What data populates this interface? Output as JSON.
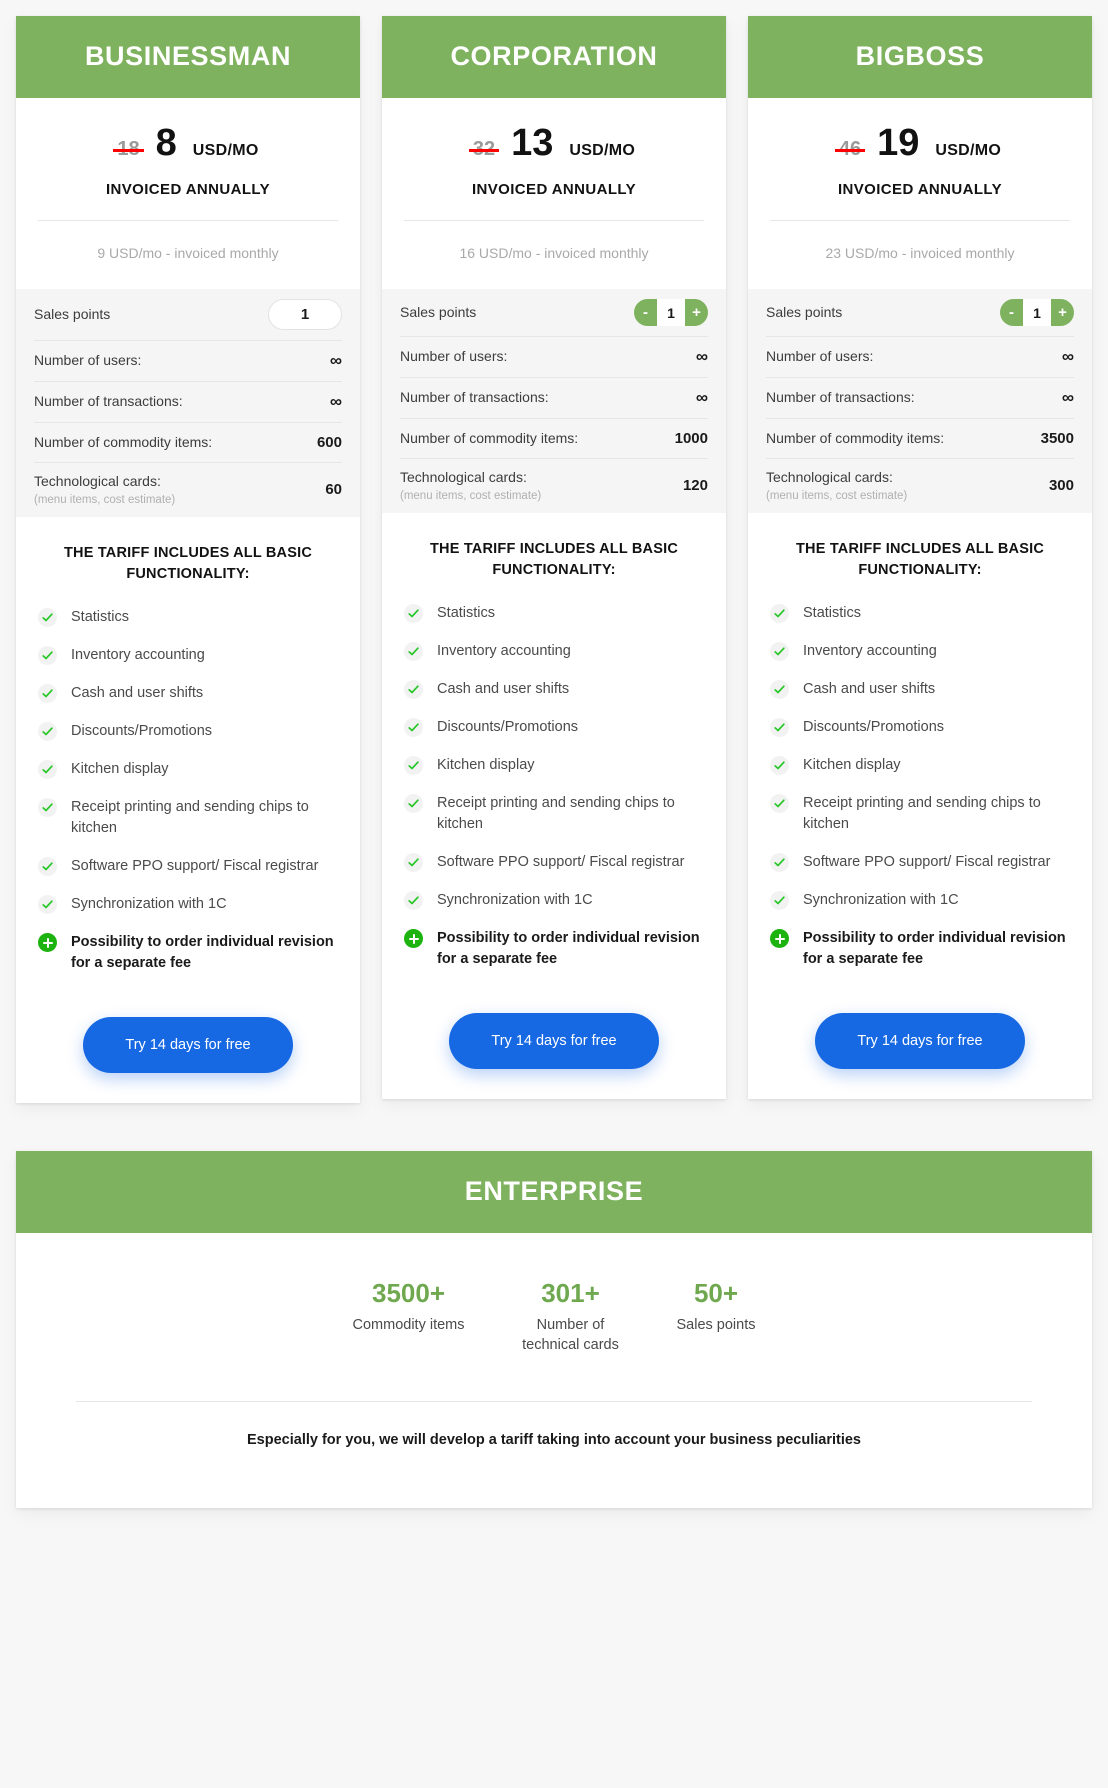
{
  "colors": {
    "header_green": "#7fb25e",
    "accent_green": "#6fa84f",
    "plus_green": "#1db30f",
    "cta_blue": "#1668e3",
    "strike_red": "#ff0000",
    "page_bg": "#f7f7f7"
  },
  "plans": [
    {
      "name": "BUSINESSMAN",
      "old_price": "18",
      "price": "8",
      "unit": "USD/MO",
      "invoiced": "INVOICED ANNUALLY",
      "monthly_note": "9 USD/mo - invoiced monthly",
      "sales_points_label": "Sales points",
      "sales_points_value": "1",
      "stepper": false,
      "minus_label": "-",
      "plus_label": "+",
      "specs": [
        {
          "label": "Number of users:",
          "sub": "",
          "value": "∞"
        },
        {
          "label": "Number of transactions:",
          "sub": "",
          "value": "∞"
        },
        {
          "label": "Number of commodity items:",
          "sub": "",
          "value": "600"
        },
        {
          "label": "Technological cards:",
          "sub": "(menu items, cost estimate)",
          "value": "60"
        }
      ],
      "features_title": "THE TARIFF INCLUDES ALL BASIC FUNCTIONALITY:",
      "features": [
        {
          "icon": "check-icon",
          "text": "Statistics"
        },
        {
          "icon": "check-icon",
          "text": "Inventory accounting"
        },
        {
          "icon": "check-icon",
          "text": "Cash and user shifts"
        },
        {
          "icon": "check-icon",
          "text": "Discounts/Promotions"
        },
        {
          "icon": "check-icon",
          "text": "Kitchen display"
        },
        {
          "icon": "check-icon",
          "text": "Receipt printing and sending chips to kitchen"
        },
        {
          "icon": "check-icon",
          "text": "Software PPO support/ Fiscal registrar"
        },
        {
          "icon": "check-icon",
          "text": "Synchronization with 1C"
        },
        {
          "icon": "plus-icon",
          "text": "Possibility to order individual revision for a separate fee"
        }
      ],
      "cta": "Try 14 days for free"
    },
    {
      "name": "CORPORATION",
      "old_price": "32",
      "price": "13",
      "unit": "USD/MO",
      "invoiced": "INVOICED ANNUALLY",
      "monthly_note": "16 USD/mo - invoiced monthly",
      "sales_points_label": "Sales points",
      "sales_points_value": "1",
      "stepper": true,
      "minus_label": "-",
      "plus_label": "+",
      "specs": [
        {
          "label": "Number of users:",
          "sub": "",
          "value": "∞"
        },
        {
          "label": "Number of transactions:",
          "sub": "",
          "value": "∞"
        },
        {
          "label": "Number of commodity items:",
          "sub": "",
          "value": "1000"
        },
        {
          "label": "Technological cards:",
          "sub": "(menu items, cost estimate)",
          "value": "120"
        }
      ],
      "features_title": "THE TARIFF INCLUDES ALL BASIC FUNCTIONALITY:",
      "features": [
        {
          "icon": "check-icon",
          "text": "Statistics"
        },
        {
          "icon": "check-icon",
          "text": "Inventory accounting"
        },
        {
          "icon": "check-icon",
          "text": "Cash and user shifts"
        },
        {
          "icon": "check-icon",
          "text": "Discounts/Promotions"
        },
        {
          "icon": "check-icon",
          "text": "Kitchen display"
        },
        {
          "icon": "check-icon",
          "text": "Receipt printing and sending chips to kitchen"
        },
        {
          "icon": "check-icon",
          "text": "Software PPO support/ Fiscal registrar"
        },
        {
          "icon": "check-icon",
          "text": "Synchronization with 1C"
        },
        {
          "icon": "plus-icon",
          "text": "Possibility to order individual revision for a separate fee"
        }
      ],
      "cta": "Try 14 days for free"
    },
    {
      "name": "BIGBOSS",
      "old_price": "46",
      "price": "19",
      "unit": "USD/MO",
      "invoiced": "INVOICED ANNUALLY",
      "monthly_note": "23 USD/mo - invoiced monthly",
      "sales_points_label": "Sales points",
      "sales_points_value": "1",
      "stepper": true,
      "minus_label": "-",
      "plus_label": "+",
      "specs": [
        {
          "label": "Number of users:",
          "sub": "",
          "value": "∞"
        },
        {
          "label": "Number of transactions:",
          "sub": "",
          "value": "∞"
        },
        {
          "label": "Number of commodity items:",
          "sub": "",
          "value": "3500"
        },
        {
          "label": "Technological cards:",
          "sub": "(menu items, cost estimate)",
          "value": "300"
        }
      ],
      "features_title": "THE TARIFF INCLUDES ALL BASIC FUNCTIONALITY:",
      "features": [
        {
          "icon": "check-icon",
          "text": "Statistics"
        },
        {
          "icon": "check-icon",
          "text": "Inventory accounting"
        },
        {
          "icon": "check-icon",
          "text": "Cash and user shifts"
        },
        {
          "icon": "check-icon",
          "text": "Discounts/Promotions"
        },
        {
          "icon": "check-icon",
          "text": "Kitchen display"
        },
        {
          "icon": "check-icon",
          "text": "Receipt printing and sending chips to kitchen"
        },
        {
          "icon": "check-icon",
          "text": "Software PPO support/ Fiscal registrar"
        },
        {
          "icon": "check-icon",
          "text": "Synchronization with 1C"
        },
        {
          "icon": "plus-icon",
          "text": "Possibility to order individual revision for a separate fee"
        }
      ],
      "cta": "Try 14 days for free"
    }
  ],
  "enterprise": {
    "name": "ENTERPRISE",
    "stats": [
      {
        "value": "3500+",
        "label": "Commodity items"
      },
      {
        "value": "301+",
        "label": "Number of technical cards"
      },
      {
        "value": "50+",
        "label": "Sales points"
      }
    ],
    "note": "Especially for you, we will develop a tariff taking into account your business peculiarities"
  }
}
